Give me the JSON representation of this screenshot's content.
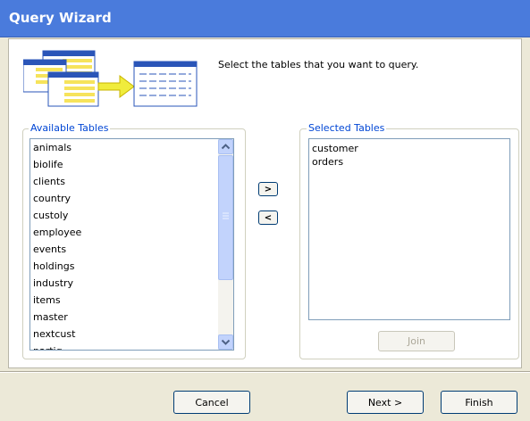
{
  "window": {
    "title": "Query Wizard"
  },
  "header": {
    "instruction": "Select the tables that you want to query."
  },
  "available": {
    "legend": "Available Tables",
    "items": [
      "animals",
      "biolife",
      "clients",
      "country",
      "custoly",
      "employee",
      "events",
      "holdings",
      "industry",
      "items",
      "master",
      "nextcust",
      "partiq"
    ]
  },
  "selected": {
    "legend": "Selected Tables",
    "items": [
      "customer",
      "orders"
    ],
    "join_label": "Join"
  },
  "transfer": {
    "add_label": ">",
    "remove_label": "<"
  },
  "footer": {
    "cancel_label": "Cancel",
    "next_label": "Next >",
    "finish_label": "Finish"
  },
  "icons": {
    "arrow": "arrow-right-icon",
    "table": "table-grid-icon"
  }
}
